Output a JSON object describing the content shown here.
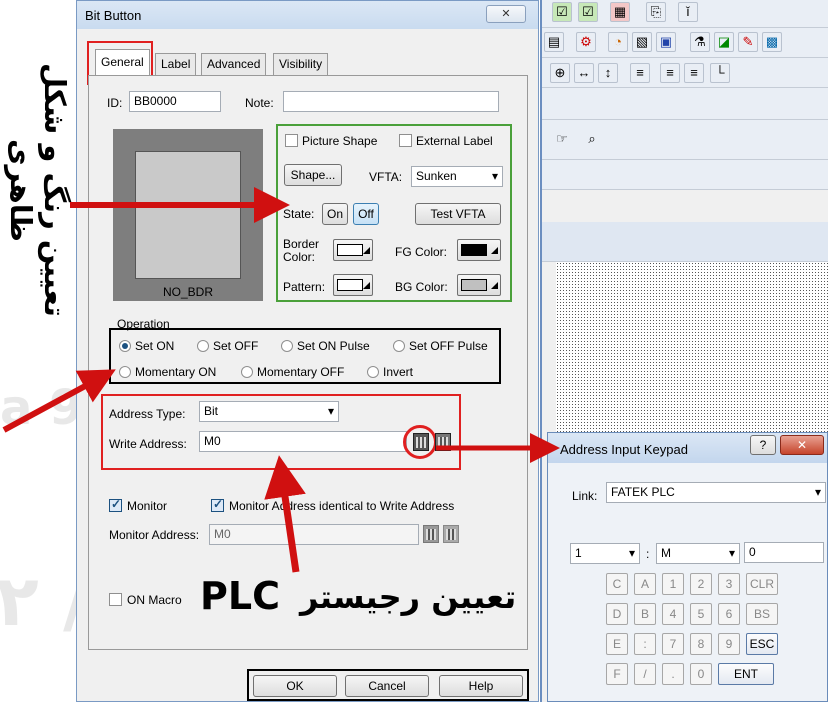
{
  "annotations": {
    "vertical_text": "تعیین رنگ و شکل ظاهری",
    "plc_text_fa": "تعیین رجیستر",
    "plc_text_en": "PLC"
  },
  "dialog": {
    "title": "Bit Button",
    "close_glyph": "✕",
    "tabs": [
      "General",
      "Label",
      "Advanced",
      "Visibility"
    ],
    "id_label": "ID:",
    "id_value": "BB0000",
    "note_label": "Note:",
    "note_value": "",
    "preview_caption": "NO_BDR",
    "picture_shape_label": "Picture Shape",
    "external_label_label": "External Label",
    "shape_button": "Shape...",
    "vfta_label": "VFTA:",
    "vfta_value": "Sunken",
    "state_label": "State:",
    "state_on": "On",
    "state_off": "Off",
    "test_vfta_button": "Test VFTA",
    "border_color_label": "Border\nColor:",
    "fg_color_label": "FG Color:",
    "pattern_label": "Pattern:",
    "bg_color_label": "BG Color:",
    "operation_group": "Operation",
    "operations": [
      {
        "label": "Set ON",
        "selected": true
      },
      {
        "label": "Set OFF",
        "selected": false
      },
      {
        "label": "Set ON Pulse",
        "selected": false
      },
      {
        "label": "Set OFF Pulse",
        "selected": false
      },
      {
        "label": "Momentary ON",
        "selected": false
      },
      {
        "label": "Momentary OFF",
        "selected": false
      },
      {
        "label": "Invert",
        "selected": false
      }
    ],
    "address_type_label": "Address Type:",
    "address_type_value": "Bit",
    "write_address_label": "Write Address:",
    "write_address_value": "M0",
    "monitor_label": "Monitor",
    "monitor_identical_label": "Monitor Address identical to Write Address",
    "monitor_address_label": "Monitor Address:",
    "monitor_address_value": "M0",
    "on_macro_label": "ON Macro",
    "ok_button": "OK",
    "cancel_button": "Cancel",
    "help_button": "Help",
    "colors": {
      "fg": "#000000",
      "bg": "#c0c0c0",
      "border": "#ffffff",
      "pattern": "#ffffff"
    }
  },
  "keypad": {
    "title": "Address Input Keypad",
    "help_glyph": "?",
    "close_glyph": "✕",
    "link_label": "Link:",
    "link_value": "FATEK PLC",
    "station_value": "1",
    "separator": ":",
    "device_value": "M",
    "address_value": "0",
    "keys": [
      [
        "C",
        "A",
        "1",
        "2",
        "3",
        "CLR"
      ],
      [
        "D",
        "B",
        "4",
        "5",
        "6",
        "BS"
      ],
      [
        "E",
        ":",
        "7",
        "8",
        "9",
        "ESC"
      ],
      [
        "F",
        "/",
        ".",
        "0",
        "ENT"
      ]
    ]
  },
  "accent_colors": {
    "red": "#e02020",
    "green": "#4aa03a",
    "arrow": "#d01010"
  }
}
